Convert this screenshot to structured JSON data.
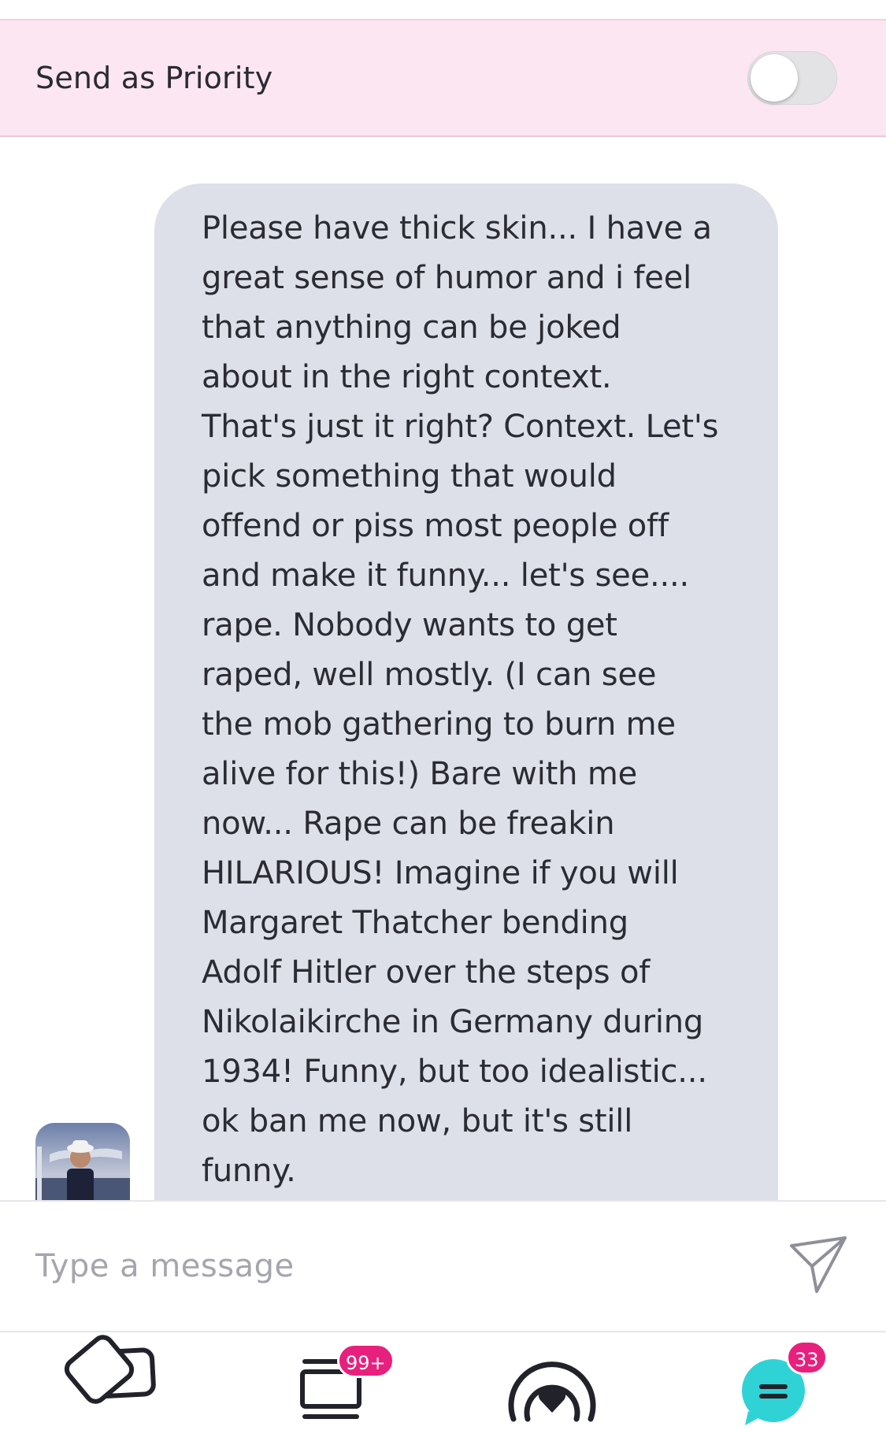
{
  "priority": {
    "label": "Send as Priority",
    "enabled": false
  },
  "message": {
    "text": "Please have thick skin... I have a\ngreat sense of humor and i feel\nthat anything can be joked\nabout in the right context.\nThat's just it right? Context.  Let's\npick something that would\noffend or piss most people off\nand make it funny... let's see....\nrape.  Nobody wants to get\nraped, well mostly.  (I can see\nthe mob gathering to burn me\nalive for this!) Bare with me\nnow... Rape can be freakin\nHILARIOUS!  Imagine if you will\nMargaret Thatcher bending\nAdolf Hitler over the steps of\nNikolaikirche in Germany during\n1934!  Funny, but too idealistic...\nok ban me now, but it's still\nfunny.",
    "bubble_color": "#dde0e9"
  },
  "composer": {
    "placeholder": "Type a message",
    "send_icon": "send-icon"
  },
  "tabbar": {
    "items": [
      {
        "icon": "cards-icon",
        "badge": ""
      },
      {
        "icon": "feed-icon",
        "badge": "99+"
      },
      {
        "icon": "live-icon",
        "badge": ""
      },
      {
        "icon": "chat-icon",
        "badge": "33"
      }
    ]
  },
  "colors": {
    "priority_bg": "#fce6f2",
    "badge": "#e8207d",
    "chat_accent": "#2fd3d6"
  }
}
